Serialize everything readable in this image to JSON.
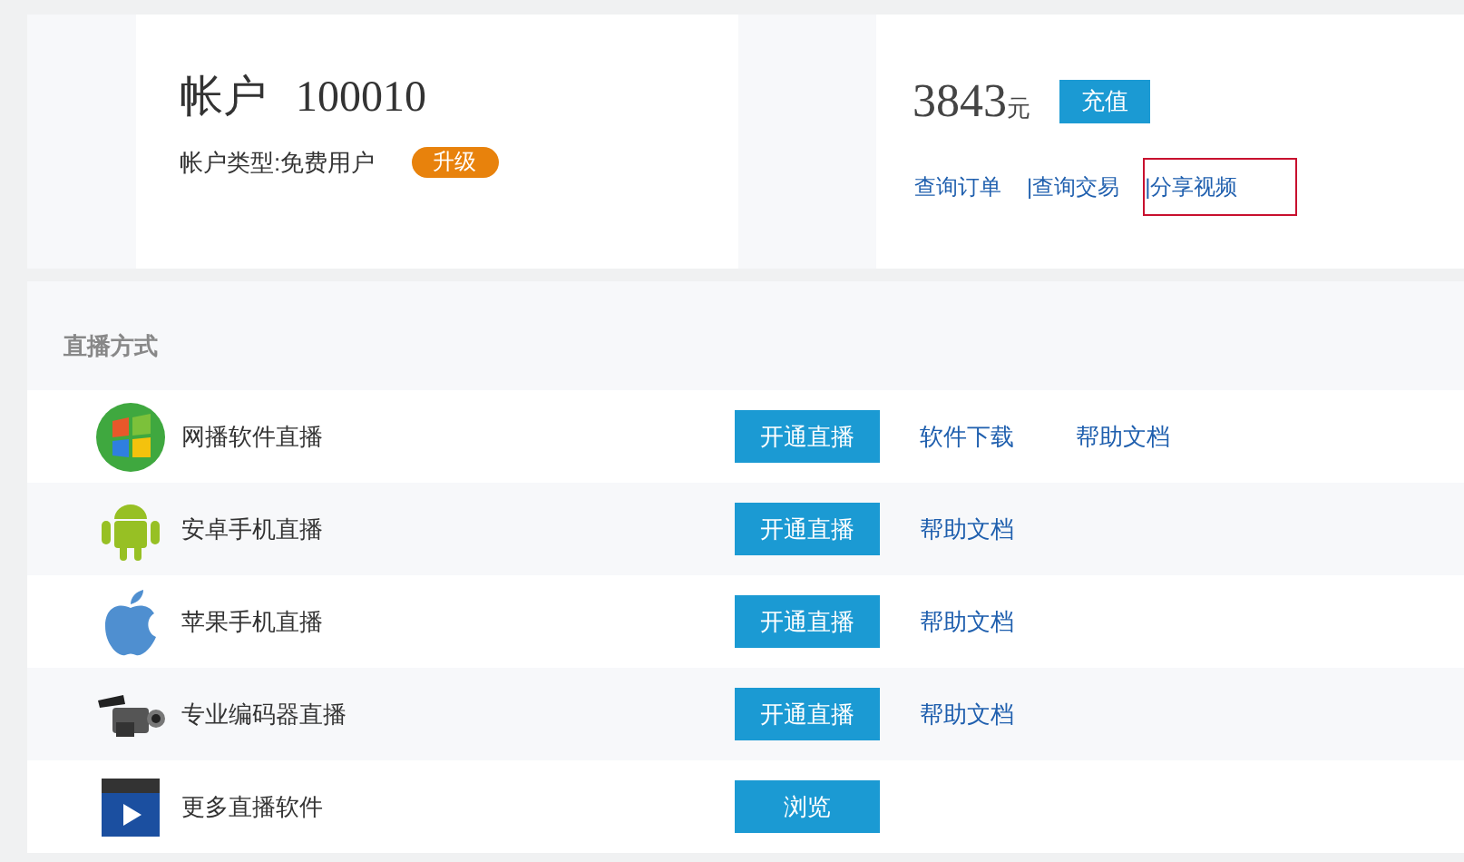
{
  "account": {
    "title": "帐户",
    "number": "100010",
    "type_label": "帐户类型:免费用户",
    "upgrade_button": "升级"
  },
  "balance": {
    "amount": "3843",
    "unit": "元",
    "recharge_button": "充值",
    "links": [
      {
        "label": "查询订单",
        "outlined": false
      },
      {
        "label": "|查询交易",
        "outlined": false
      },
      {
        "label": "|分享视频",
        "outlined": true
      }
    ]
  },
  "live_methods": {
    "heading": "直播方式",
    "rows": [
      {
        "kind": "windows",
        "name": "网播软件直播",
        "button": "开通直播",
        "links": [
          "软件下载",
          "帮助文档"
        ]
      },
      {
        "kind": "android",
        "name": "安卓手机直播",
        "button": "开通直播",
        "links": [
          "帮助文档"
        ]
      },
      {
        "kind": "apple",
        "name": "苹果手机直播",
        "button": "开通直播",
        "links": [
          "帮助文档"
        ]
      },
      {
        "kind": "camcorder",
        "name": "专业编码器直播",
        "button": "开通直播",
        "links": [
          "帮助文档"
        ]
      },
      {
        "kind": "clapper",
        "name": "更多直播软件",
        "button": "浏览"
      }
    ]
  }
}
